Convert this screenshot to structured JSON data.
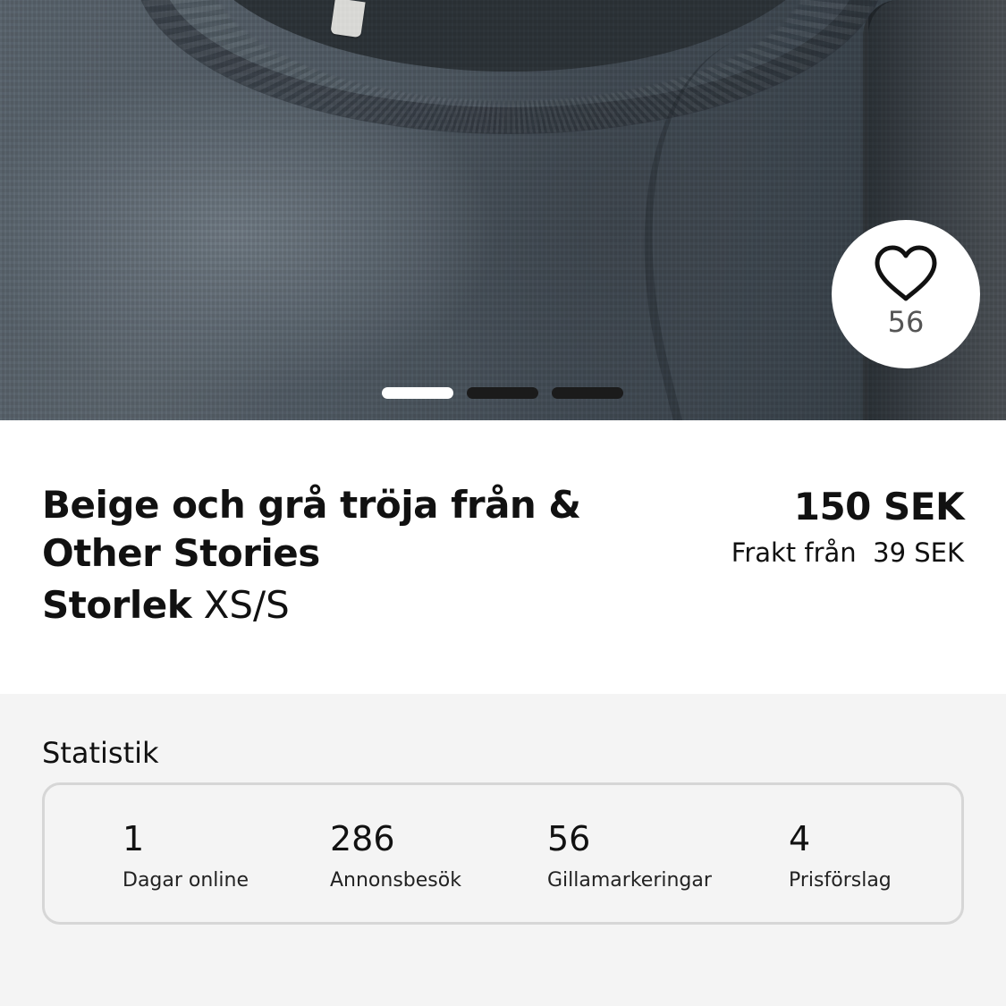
{
  "gallery": {
    "image_alt": "Grå stickad tröja",
    "slide_count": 3,
    "active_slide": 1,
    "like_count": "56"
  },
  "listing": {
    "title": "Beige och grå tröja från & Other Stories",
    "size_label": "Storlek",
    "size_value": "XS/S",
    "price": "150 SEK",
    "shipping": "Frakt från  39 SEK"
  },
  "stats": {
    "heading": "Statistik",
    "items": [
      {
        "value": "1",
        "label": "Dagar online"
      },
      {
        "value": "286",
        "label": "Annonsbesök"
      },
      {
        "value": "56",
        "label": "Gillamarkeringar"
      },
      {
        "value": "4",
        "label": "Prisförslag"
      }
    ]
  },
  "colors": {
    "accent_white": "#ffffff",
    "stats_background": "#f4f4f4",
    "stats_border": "#d6d6d6"
  }
}
